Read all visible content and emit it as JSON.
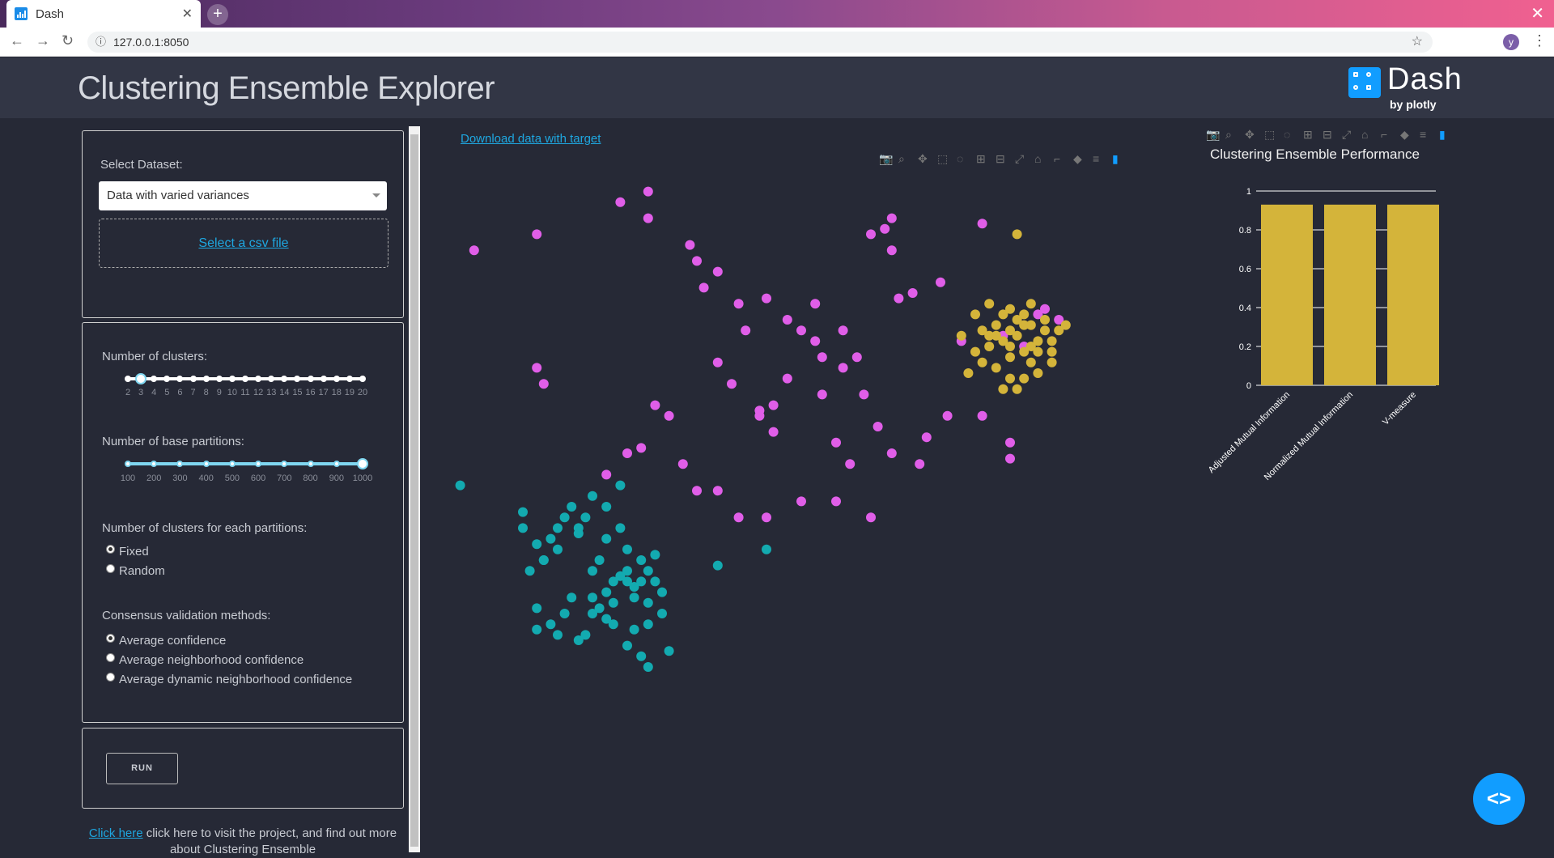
{
  "browser": {
    "tab_title": "Dash",
    "url": "127.0.0.1:8050",
    "profile_initial": "y"
  },
  "header": {
    "title": "Clustering Ensemble Explorer",
    "logo_name": "Dash",
    "logo_by": "by plotly"
  },
  "sidebar": {
    "dataset_label": "Select Dataset:",
    "dataset_value": "Data with varied variances",
    "upload_label": "Select a csv file",
    "clusters_label": "Number of clusters:",
    "clusters_ticks": [
      "2",
      "3",
      "4",
      "5",
      "6",
      "7",
      "8",
      "9",
      "10",
      "11",
      "12",
      "13",
      "14",
      "15",
      "16",
      "17",
      "18",
      "19",
      "20"
    ],
    "clusters_value": 3,
    "partitions_label": "Number of base partitions:",
    "partitions_ticks": [
      "100",
      "200",
      "300",
      "400",
      "500",
      "600",
      "700",
      "800",
      "900",
      "1000"
    ],
    "partitions_value": 1000,
    "each_label": "Number of clusters for each partitions:",
    "each_options": [
      "Fixed",
      "Random"
    ],
    "each_selected": "Fixed",
    "consensus_label": "Consensus validation methods:",
    "consensus_options": [
      "Average confidence",
      "Average neighborhood confidence",
      "Average dynamic neighborhood confidence"
    ],
    "consensus_selected": "Average confidence",
    "run_label": "RUN",
    "footer_link": "Click here",
    "footer_text": " click here to visit the project, and find out more about Clustering Ensemble"
  },
  "main": {
    "download_link": "Download data with target"
  },
  "colors": {
    "magenta": "#e05ee8",
    "teal": "#13aab0",
    "gold": "#d4b43a",
    "accent": "#119dff"
  },
  "chart_data": [
    {
      "type": "scatter",
      "title": "",
      "series": [
        {
          "color": "magenta",
          "x": [
            0.03,
            0.12,
            0.24,
            0.28,
            0.28,
            0.34,
            0.35,
            0.36,
            0.38,
            0.41,
            0.45,
            0.48,
            0.52,
            0.52,
            0.56,
            0.58,
            0.6,
            0.62,
            0.63,
            0.63,
            0.66,
            0.7,
            0.73,
            0.79,
            0.82,
            0.84,
            0.85,
            0.87,
            0.76,
            0.64,
            0.5,
            0.42,
            0.38,
            0.4,
            0.44,
            0.46,
            0.48,
            0.53,
            0.55,
            0.59,
            0.61,
            0.25,
            0.22,
            0.27,
            0.33,
            0.35,
            0.38,
            0.41,
            0.45,
            0.5,
            0.55,
            0.57,
            0.63,
            0.68,
            0.71,
            0.76,
            0.8,
            0.8,
            0.12,
            0.13,
            0.29,
            0.31,
            0.44,
            0.46,
            0.53,
            0.56,
            0.6,
            0.67
          ],
          "y": [
            0.12,
            0.09,
            0.03,
            0.06,
            0.01,
            0.11,
            0.14,
            0.19,
            0.16,
            0.22,
            0.21,
            0.25,
            0.22,
            0.29,
            0.27,
            0.32,
            0.09,
            0.08,
            0.06,
            0.12,
            0.2,
            0.18,
            0.29,
            0.28,
            0.3,
            0.24,
            0.23,
            0.25,
            0.07,
            0.21,
            0.27,
            0.27,
            0.33,
            0.37,
            0.42,
            0.46,
            0.36,
            0.39,
            0.48,
            0.39,
            0.45,
            0.5,
            0.54,
            0.49,
            0.52,
            0.57,
            0.57,
            0.62,
            0.62,
            0.59,
            0.59,
            0.52,
            0.5,
            0.47,
            0.43,
            0.43,
            0.51,
            0.48,
            0.34,
            0.37,
            0.41,
            0.43,
            0.43,
            0.41,
            0.32,
            0.34,
            0.62,
            0.52
          ]
        },
        {
          "color": "teal",
          "x": [
            0.01,
            0.1,
            0.1,
            0.12,
            0.13,
            0.15,
            0.16,
            0.18,
            0.2,
            0.21,
            0.22,
            0.23,
            0.25,
            0.27,
            0.28,
            0.29,
            0.3,
            0.12,
            0.14,
            0.16,
            0.17,
            0.19,
            0.2,
            0.22,
            0.23,
            0.25,
            0.26,
            0.27,
            0.28,
            0.29,
            0.24,
            0.22,
            0.2,
            0.19,
            0.18,
            0.17,
            0.15,
            0.14,
            0.13,
            0.11,
            0.31,
            0.26,
            0.28,
            0.25,
            0.23,
            0.21,
            0.45,
            0.38,
            0.24,
            0.12,
            0.15,
            0.18,
            0.2,
            0.22,
            0.24,
            0.26,
            0.28,
            0.3,
            0.27,
            0.25
          ],
          "y": [
            0.56,
            0.61,
            0.64,
            0.67,
            0.7,
            0.68,
            0.62,
            0.64,
            0.72,
            0.7,
            0.66,
            0.74,
            0.68,
            0.7,
            0.72,
            0.74,
            0.76,
            0.79,
            0.82,
            0.8,
            0.77,
            0.84,
            0.8,
            0.81,
            0.78,
            0.74,
            0.77,
            0.74,
            0.78,
            0.69,
            0.64,
            0.6,
            0.58,
            0.62,
            0.65,
            0.6,
            0.64,
            0.66,
            0.7,
            0.72,
            0.87,
            0.83,
            0.9,
            0.86,
            0.82,
            0.79,
            0.68,
            0.71,
            0.56,
            0.83,
            0.84,
            0.85,
            0.77,
            0.76,
            0.73,
            0.75,
            0.82,
            0.8,
            0.88,
            0.72
          ]
        },
        {
          "color": "gold",
          "x": [
            0.73,
            0.75,
            0.76,
            0.77,
            0.78,
            0.79,
            0.8,
            0.81,
            0.82,
            0.83,
            0.84,
            0.85,
            0.86,
            0.79,
            0.8,
            0.81,
            0.82,
            0.83,
            0.78,
            0.77,
            0.76,
            0.82,
            0.84,
            0.86,
            0.8,
            0.81,
            0.79,
            0.83,
            0.85,
            0.87,
            0.74,
            0.88,
            0.81,
            0.78,
            0.84,
            0.8,
            0.77,
            0.82,
            0.75,
            0.86,
            0.8,
            0.83
          ],
          "y": [
            0.28,
            0.31,
            0.27,
            0.3,
            0.26,
            0.29,
            0.32,
            0.28,
            0.26,
            0.3,
            0.31,
            0.27,
            0.29,
            0.24,
            0.23,
            0.25,
            0.24,
            0.33,
            0.34,
            0.22,
            0.33,
            0.36,
            0.35,
            0.33,
            0.36,
            0.38,
            0.38,
            0.22,
            0.25,
            0.27,
            0.35,
            0.26,
            0.09,
            0.28,
            0.29,
            0.3,
            0.28,
            0.31,
            0.24,
            0.31,
            0.27,
            0.26
          ]
        }
      ]
    },
    {
      "type": "bar",
      "title": "Clustering Ensemble Performance",
      "categories": [
        "Adjusted Mutual Information",
        "Normalized Mutual Information",
        "V-measure"
      ],
      "values": [
        0.93,
        0.93,
        0.93
      ],
      "yticks": [
        "0",
        "0.2",
        "0.4",
        "0.6",
        "0.8",
        "1"
      ],
      "ylim": [
        0,
        1
      ]
    }
  ]
}
